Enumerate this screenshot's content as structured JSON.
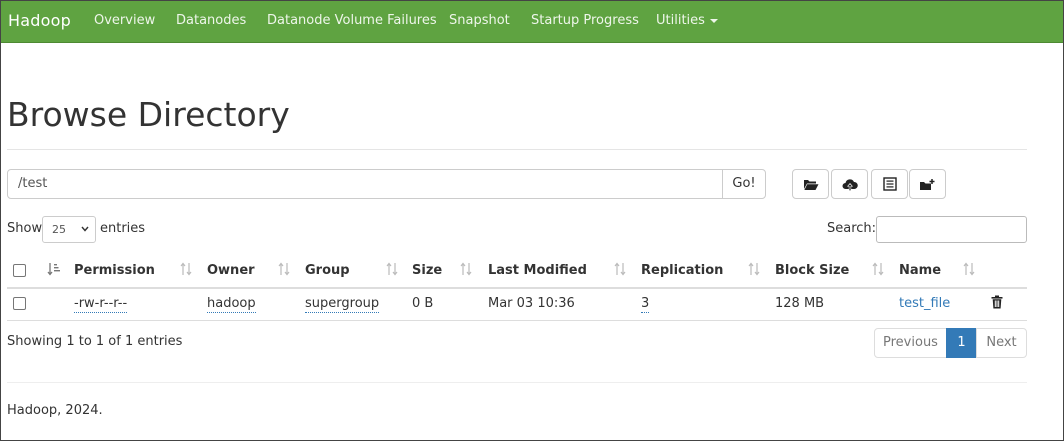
{
  "nav": {
    "brand": "Hadoop",
    "items": [
      "Overview",
      "Datanodes",
      "Datanode Volume Failures",
      "Snapshot",
      "Startup Progress",
      "Utilities"
    ]
  },
  "page_title": "Browse Directory",
  "path": {
    "value": "/test",
    "go_label": "Go!"
  },
  "toolbar": {
    "icons": [
      "folder-open-icon",
      "cloud-upload-icon",
      "list-icon",
      "folder-plus-icon"
    ]
  },
  "entries": {
    "show_label": "Show",
    "selected": "25",
    "suffix_label": "entries"
  },
  "search": {
    "label": "Search:",
    "value": ""
  },
  "table": {
    "headers": [
      "Permission",
      "Owner",
      "Group",
      "Size",
      "Last Modified",
      "Replication",
      "Block Size",
      "Name"
    ],
    "rows": [
      {
        "permission": "-rw-r--r--",
        "owner": "hadoop",
        "group": "supergroup",
        "size": "0 B",
        "last_modified": "Mar 03 10:36",
        "replication": "3",
        "block_size": "128 MB",
        "name": "test_file"
      }
    ]
  },
  "info": "Showing 1 to 1 of 1 entries",
  "pagination": {
    "previous": "Previous",
    "current": "1",
    "next": "Next"
  },
  "footer": "Hadoop, 2024.",
  "colors": {
    "navbar": "#5fa341",
    "link": "#337ab7",
    "active_page": "#337ab7"
  }
}
